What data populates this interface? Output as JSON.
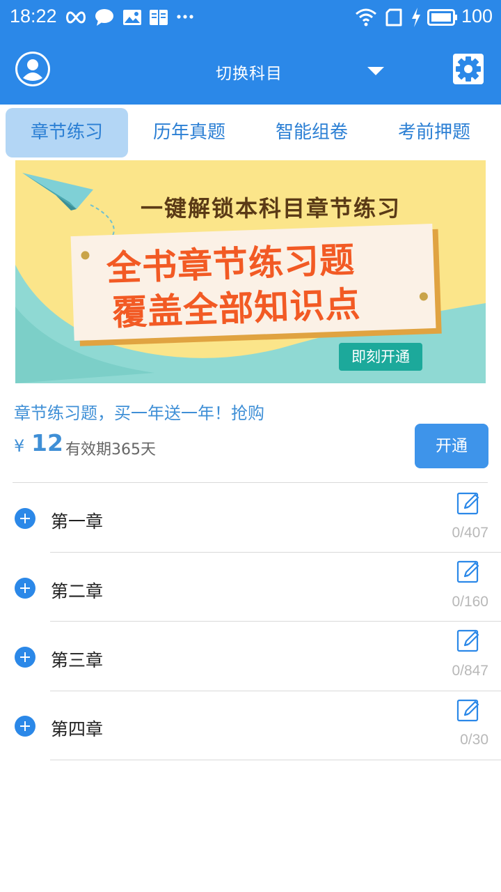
{
  "status_bar": {
    "time": "18:22",
    "battery": "100",
    "icons": [
      "infinity-icon",
      "chat-icon",
      "image-icon",
      "book-icon",
      "more-icon",
      "wifi-icon",
      "sim-icon",
      "charging-icon",
      "battery-icon"
    ]
  },
  "header": {
    "subject_label": "切换科目",
    "avatar_icon": "user-icon",
    "dropdown_icon": "caret-down-icon",
    "settings_icon": "gear-icon"
  },
  "tabs": [
    {
      "label": "章节练习",
      "active": true
    },
    {
      "label": "历年真题",
      "active": false
    },
    {
      "label": "智能组卷",
      "active": false
    },
    {
      "label": "考前押题",
      "active": false
    }
  ],
  "banner": {
    "headline": "一键解锁本科目章节练习",
    "line1": "全书章节练习题",
    "line2": "覆盖全部知识点",
    "cta": "即刻开通"
  },
  "promo": {
    "title": "章节练习题，买一年送一年！抢购",
    "currency": "¥",
    "price": "12",
    "validity": "有效期365天",
    "open_button": "开通"
  },
  "chapters": [
    {
      "label": "第一章",
      "count": "0/407"
    },
    {
      "label": "第二章",
      "count": "0/160"
    },
    {
      "label": "第三章",
      "count": "0/847"
    },
    {
      "label": "第四章",
      "count": "0/30"
    }
  ],
  "colors": {
    "primary": "#2b88e8",
    "tab_active_bg": "#b3d6f5",
    "tab_text": "#2b7fd4",
    "promo_text": "#3f8fd6",
    "button": "#3e94ea",
    "count_text": "#b8b8b8"
  }
}
